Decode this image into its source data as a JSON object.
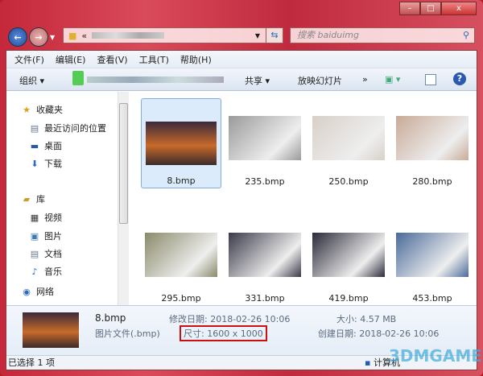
{
  "window": {
    "minimize": "–",
    "maximize": "□",
    "close": "x"
  },
  "address": {
    "prefix": "«",
    "search_placeholder": "搜索 baiduimg"
  },
  "menu": [
    "文件(F)",
    "编辑(E)",
    "查看(V)",
    "工具(T)",
    "帮助(H)"
  ],
  "toolbar": {
    "organize": "组织 ▾",
    "share": "共享 ▾",
    "slideshow": "放映幻灯片",
    "more": "»"
  },
  "sidebar": [
    {
      "label": "收藏夹",
      "icon": "star-icon"
    },
    {
      "label": "最近访问的位置",
      "icon": "recent-icon"
    },
    {
      "label": "桌面",
      "icon": "desktop-icon"
    },
    {
      "label": "下载",
      "icon": "download-icon"
    },
    {
      "label": "库",
      "icon": "library-icon"
    },
    {
      "label": "视频",
      "icon": "video-icon"
    },
    {
      "label": "图片",
      "icon": "picture-icon"
    },
    {
      "label": "文档",
      "icon": "document-icon"
    },
    {
      "label": "音乐",
      "icon": "music-icon"
    },
    {
      "label": "网络",
      "icon": "network-icon"
    }
  ],
  "files": [
    {
      "name": "8.bmp",
      "selected": true,
      "color": "#c8662a"
    },
    {
      "name": "235.bmp",
      "color": "#9a9a9a"
    },
    {
      "name": "250.bmp",
      "color": "#d8d0c8"
    },
    {
      "name": "280.bmp",
      "color": "#c8aa98"
    },
    {
      "name": "295.bmp",
      "color": "#8a8a6a"
    },
    {
      "name": "331.bmp",
      "color": "#3a3a4a"
    },
    {
      "name": "419.bmp",
      "color": "#2a2a3a"
    },
    {
      "name": "453.bmp",
      "color": "#4a6a9a"
    }
  ],
  "details": {
    "name": "8.bmp",
    "type": "图片文件(.bmp)",
    "modified": "修改日期: 2018-02-26  10:06",
    "dimensions": "尺寸: 1600 x 1000",
    "size": "大小: 4.57 MB",
    "created": "创建日期: 2018-02-26  10:06"
  },
  "status": {
    "selected": "已选择 1 项",
    "computer": "计算机"
  },
  "watermark": "3DMGAME"
}
